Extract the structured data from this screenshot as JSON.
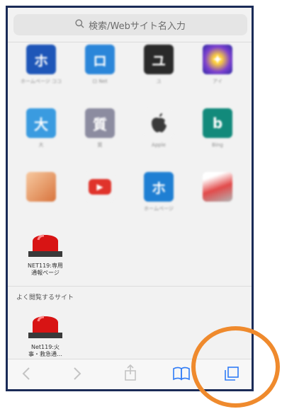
{
  "search": {
    "placeholder": "検索/Webサイト名入力"
  },
  "favorites": [
    {
      "glyph": "ホ",
      "color": "#1e56b8",
      "caption": "ホームページ\nココ"
    },
    {
      "glyph": "ロ",
      "color": "#2b86d9",
      "caption": "ロ \nNet"
    },
    {
      "glyph": "ユ",
      "color": "#2a2a2a",
      "caption": "ユ"
    },
    {
      "glyph": "✦",
      "color": "#5d3fb0",
      "caption": "アイ"
    },
    {
      "glyph": "大",
      "color": "#3a9be0",
      "caption": "大"
    },
    {
      "glyph": "質",
      "color": "#8c8ca0",
      "caption": "質"
    },
    {
      "glyph": "",
      "color": "#f2f2f2",
      "caption": "Apple"
    },
    {
      "glyph": "b",
      "color": "#128a7b",
      "caption": "Bing"
    },
    {
      "glyph": "",
      "color": "#e8955c",
      "caption": ""
    },
    {
      "glyph": "▶",
      "color": "#f2f2f2",
      "caption": ""
    },
    {
      "glyph": "ホ",
      "color": "#1f7fd3",
      "caption": "ホームページ"
    },
    {
      "glyph": "",
      "color": "#d9534f",
      "caption": ""
    }
  ],
  "net119_favorite": {
    "label_line1": "NET119:専用",
    "label_line2": "通報ページ"
  },
  "frequently_visited": {
    "title": "よく閲覧するサイト",
    "item": {
      "label_line1": "Net119:火",
      "label_line2": "事・救急通…"
    }
  },
  "toolbar": {
    "back_icon": "chevron-left",
    "forward_icon": "chevron-right",
    "share_icon": "share",
    "bookmarks_icon": "book",
    "tabs_icon": "tabs"
  },
  "colors": {
    "accent": "#2f7bf6",
    "frame": "#1a2b57",
    "highlight_ring": "#ef8a2d"
  }
}
